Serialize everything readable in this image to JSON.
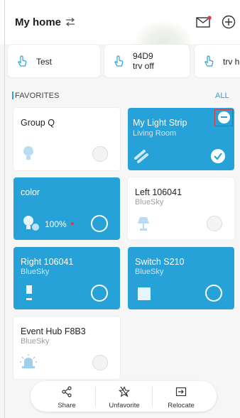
{
  "header": {
    "title": "My home",
    "icons": {
      "switch": "switch-arrows-icon",
      "mail": "mail-icon",
      "add": "add-circle-icon"
    },
    "mail_badge_color": "#e0363e"
  },
  "scenes": [
    {
      "label": "Test"
    },
    {
      "label_line1": "94D9",
      "label_line2": "trv off"
    },
    {
      "label": "trv h"
    }
  ],
  "favorites": {
    "title": "FAVORITES",
    "all_label": "ALL",
    "cards": [
      {
        "name": "Group Q",
        "sub": "",
        "state": "off",
        "icon": "bulb-icon"
      },
      {
        "name": "My Light Strip",
        "sub": "Living Room",
        "state": "on",
        "selected": true,
        "icon": "light-strip-icon"
      },
      {
        "name": "color",
        "sub": "",
        "state": "on",
        "brightness": "100%",
        "icon": "bulb-icon"
      },
      {
        "name": "Left 106041",
        "sub": "BlueSky",
        "state": "off",
        "icon": "lamp-icon"
      },
      {
        "name": "Right 106041",
        "sub": "BlueSky",
        "state": "on",
        "icon": "plug-icon"
      },
      {
        "name": "Switch S210",
        "sub": "BlueSky",
        "state": "on",
        "icon": "switch-panel-icon"
      },
      {
        "name": "Event Hub F8B3",
        "sub": "BlueSky",
        "state": "off",
        "icon": "alarm-icon"
      }
    ]
  },
  "actions": [
    {
      "label": "Share",
      "icon": "share-icon"
    },
    {
      "label": "Unfavorite",
      "icon": "unfavorite-star-icon"
    },
    {
      "label": "Relocate",
      "icon": "relocate-icon"
    }
  ],
  "colors": {
    "accent": "#27a2d9",
    "danger": "#e0363e"
  }
}
